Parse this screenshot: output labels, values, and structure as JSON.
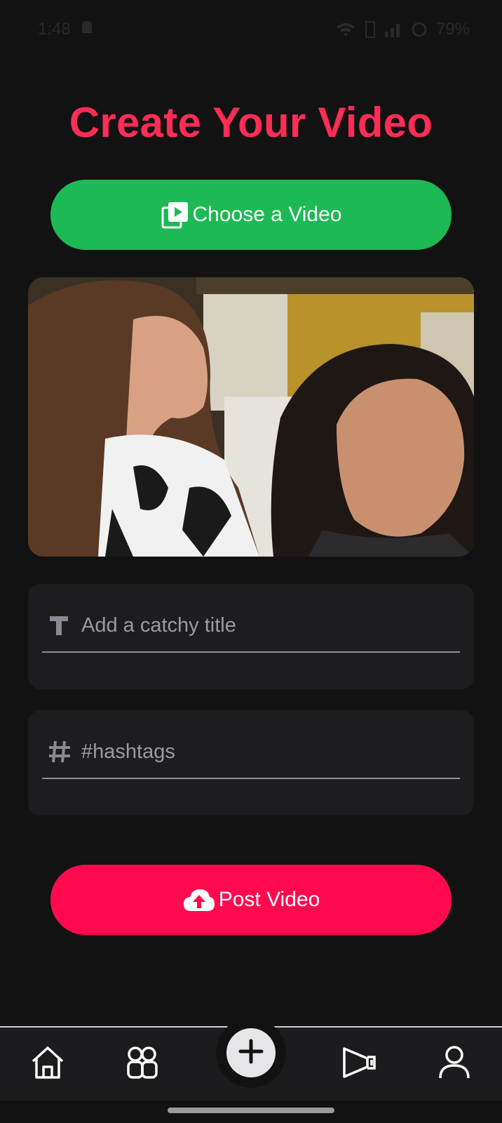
{
  "status_bar": {
    "time": "1:48",
    "battery": "79%",
    "icons": [
      "notification-icon",
      "wifi-icon",
      "volte-icon",
      "signal-icon",
      "battery-icon"
    ]
  },
  "page": {
    "title": "Create Your Video"
  },
  "choose_button": {
    "label": "Choose a Video",
    "icon": "video-library-icon"
  },
  "video_preview": {
    "description_icon": "video-thumbnail"
  },
  "title_input": {
    "placeholder": "Add a catchy title",
    "value": "",
    "icon": "text-icon"
  },
  "hashtags_input": {
    "placeholder": "#hashtags",
    "value": "",
    "icon": "hashtag-icon"
  },
  "post_button": {
    "label": "Post Video",
    "icon": "cloud-upload-icon"
  },
  "bottom_nav": {
    "items": [
      {
        "name": "home",
        "icon": "home-icon"
      },
      {
        "name": "groups",
        "icon": "groups-icon"
      },
      {
        "name": "create",
        "icon": "plus-icon"
      },
      {
        "name": "ads",
        "icon": "megaphone-icon"
      },
      {
        "name": "profile",
        "icon": "user-icon"
      }
    ]
  },
  "colors": {
    "background": "#121213",
    "title": "#ff2d55",
    "choose_button": "#1db954",
    "post_button": "#ff0a4e",
    "input_card": "#1d1d20"
  }
}
